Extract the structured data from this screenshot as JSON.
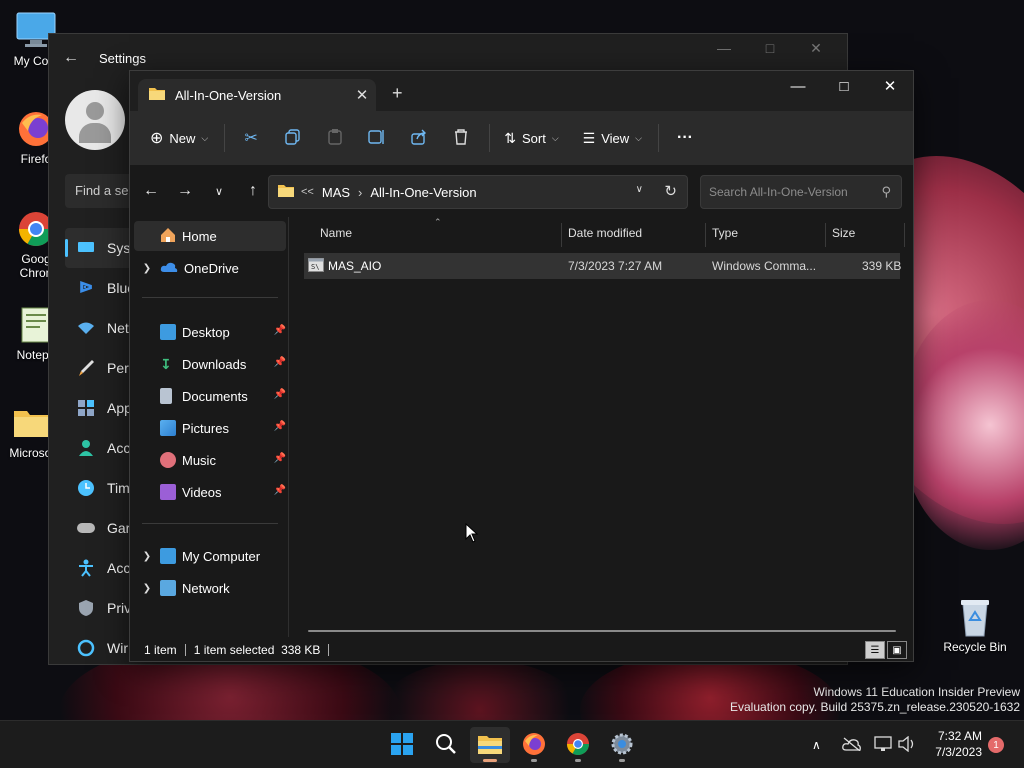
{
  "desktop": {
    "icons": [
      {
        "label": "My Computer",
        "display": "My Com"
      },
      {
        "label": "Firefox",
        "display": "Firefo"
      },
      {
        "label": "Google Chrome",
        "display1": "Goog",
        "display2": "Chron"
      },
      {
        "label": "Notepad",
        "display": "Notepa"
      },
      {
        "label": "Microsoft",
        "display": "Microsof"
      }
    ],
    "recycle_bin": "Recycle Bin",
    "watermark_line1": "Windows 11 Education Insider Preview",
    "watermark_line2": "Evaluation copy. Build 25375.zn_release.230520-1632"
  },
  "settings": {
    "title": "Settings",
    "find_placeholder": "Find a se",
    "nav": [
      {
        "label": "Syst",
        "icon": "system-icon",
        "color": "#4cc2ff"
      },
      {
        "label": "Blue",
        "icon": "bluetooth-icon",
        "color": "#3b8eea"
      },
      {
        "label": "Net",
        "icon": "wifi-icon",
        "color": "#5ab0f0"
      },
      {
        "label": "Pers",
        "icon": "brush-icon",
        "color": "#f5a542"
      },
      {
        "label": "App",
        "icon": "apps-icon",
        "color": "#8fa6c8"
      },
      {
        "label": "Acc",
        "icon": "account-icon",
        "color": "#2ec4a5"
      },
      {
        "label": "Tim",
        "icon": "time-icon",
        "color": "#4cc2ff"
      },
      {
        "label": "Gar",
        "icon": "gaming-icon",
        "color": "#b8b8b8"
      },
      {
        "label": "Acc",
        "icon": "accessibility-icon",
        "color": "#4cc2ff"
      },
      {
        "label": "Priv",
        "icon": "shield-icon",
        "color": "#9aa4b0"
      },
      {
        "label": "Wir",
        "icon": "update-icon",
        "color": "#4cc2ff"
      }
    ]
  },
  "explorer": {
    "tab_title": "All-In-One-Version",
    "toolbar": {
      "new_label": "New",
      "sort_label": "Sort",
      "view_label": "View",
      "more_label": "···"
    },
    "address": {
      "overflow": "<<",
      "crumbs": [
        "MAS",
        "All-In-One-Version"
      ]
    },
    "search_placeholder": "Search All-In-One-Version",
    "nav": {
      "home": "Home",
      "onedrive": "OneDrive",
      "quick": [
        "Desktop",
        "Downloads",
        "Documents",
        "Pictures",
        "Music",
        "Videos"
      ],
      "my_computer": "My Computer",
      "network": "Network"
    },
    "columns": {
      "name": "Name",
      "date": "Date modified",
      "type": "Type",
      "size": "Size"
    },
    "files": [
      {
        "name": "MAS_AIO",
        "date": "7/3/2023 7:27 AM",
        "type": "Windows Comma...",
        "size": "339 KB"
      }
    ],
    "status": {
      "count": "1 item",
      "selection": "1 item selected  338 KB"
    }
  },
  "taskbar": {
    "time": "7:32 AM",
    "date": "7/3/2023",
    "notification_count": "1",
    "apps": [
      "start-icon",
      "search-icon",
      "file-explorer-icon",
      "firefox-icon",
      "chrome-icon",
      "settings-icon"
    ]
  }
}
